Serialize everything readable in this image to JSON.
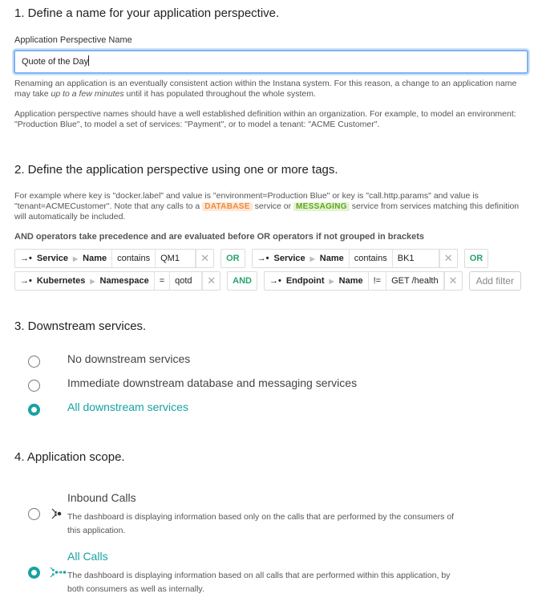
{
  "section1": {
    "heading": "1. Define a name for your application perspective.",
    "field_label": "Application Perspective Name",
    "field_value": "Quote of the Day",
    "help1_a": "Renaming an application is an eventually consistent action within the Instana system. For this reason, a change to an application name may take ",
    "help1_em": "up to a few minutes",
    "help1_b": " until it has populated throughout the whole system.",
    "help2": "Application perspective names should have a well established definition within an organization. For example, to model an environment: \"Production Blue\", to model a set of services: \"Payment\", or to model a tenant: \"ACME Customer\"."
  },
  "section2": {
    "heading": "2. Define the application perspective using one or more tags.",
    "help_a": "For example where key is \"docker.label\" and value is \"environment=Production Blue\" or key is \"call.http.params\" and value is \"tenant=ACMECustomer\". Note that any calls to a ",
    "tag_database": "DATABASE",
    "help_b": " service or ",
    "tag_messaging": "MESSAGING",
    "help_c": " service from services matching this definition will automatically be included.",
    "operator_note": "AND operators take precedence and are evaluated before OR operators if not grouped in brackets",
    "filters": [
      {
        "entity": "Service",
        "attr": "Name",
        "op": "contains",
        "value": "QM1"
      },
      {
        "entity": "Service",
        "attr": "Name",
        "op": "contains",
        "value": "BK1"
      },
      {
        "entity": "Kubernetes",
        "attr": "Namespace",
        "op": "=",
        "value": "qotd"
      },
      {
        "entity": "Endpoint",
        "attr": "Name",
        "op": "!=",
        "value": "GET /health"
      }
    ],
    "logic": [
      "OR",
      "OR",
      "AND"
    ],
    "add_filter": "Add filter",
    "arrow_glyph": "→•",
    "remove_glyph": "✕"
  },
  "section3": {
    "heading": "3. Downstream services.",
    "options": [
      "No downstream services",
      "Immediate downstream database and messaging services",
      "All downstream services"
    ],
    "selected_index": 2
  },
  "section4": {
    "heading": "4. Application scope.",
    "options": [
      {
        "title": "Inbound Calls",
        "desc": "The dashboard is displaying information based only on the calls that are performed by the consumers of this application.",
        "icon": "inbound-calls-icon"
      },
      {
        "title": "All Calls",
        "desc": "The dashboard is displaying information based on all calls that are performed within this application, by both consumers as well as internally.",
        "icon": "all-calls-icon"
      }
    ],
    "selected_index": 1
  },
  "colors": {
    "accent": "#17a2a2",
    "logic_green": "#27a36e",
    "database_tag": "#f08a3c",
    "messaging_tag": "#5fa620",
    "focus_border": "#7fb3f0"
  }
}
